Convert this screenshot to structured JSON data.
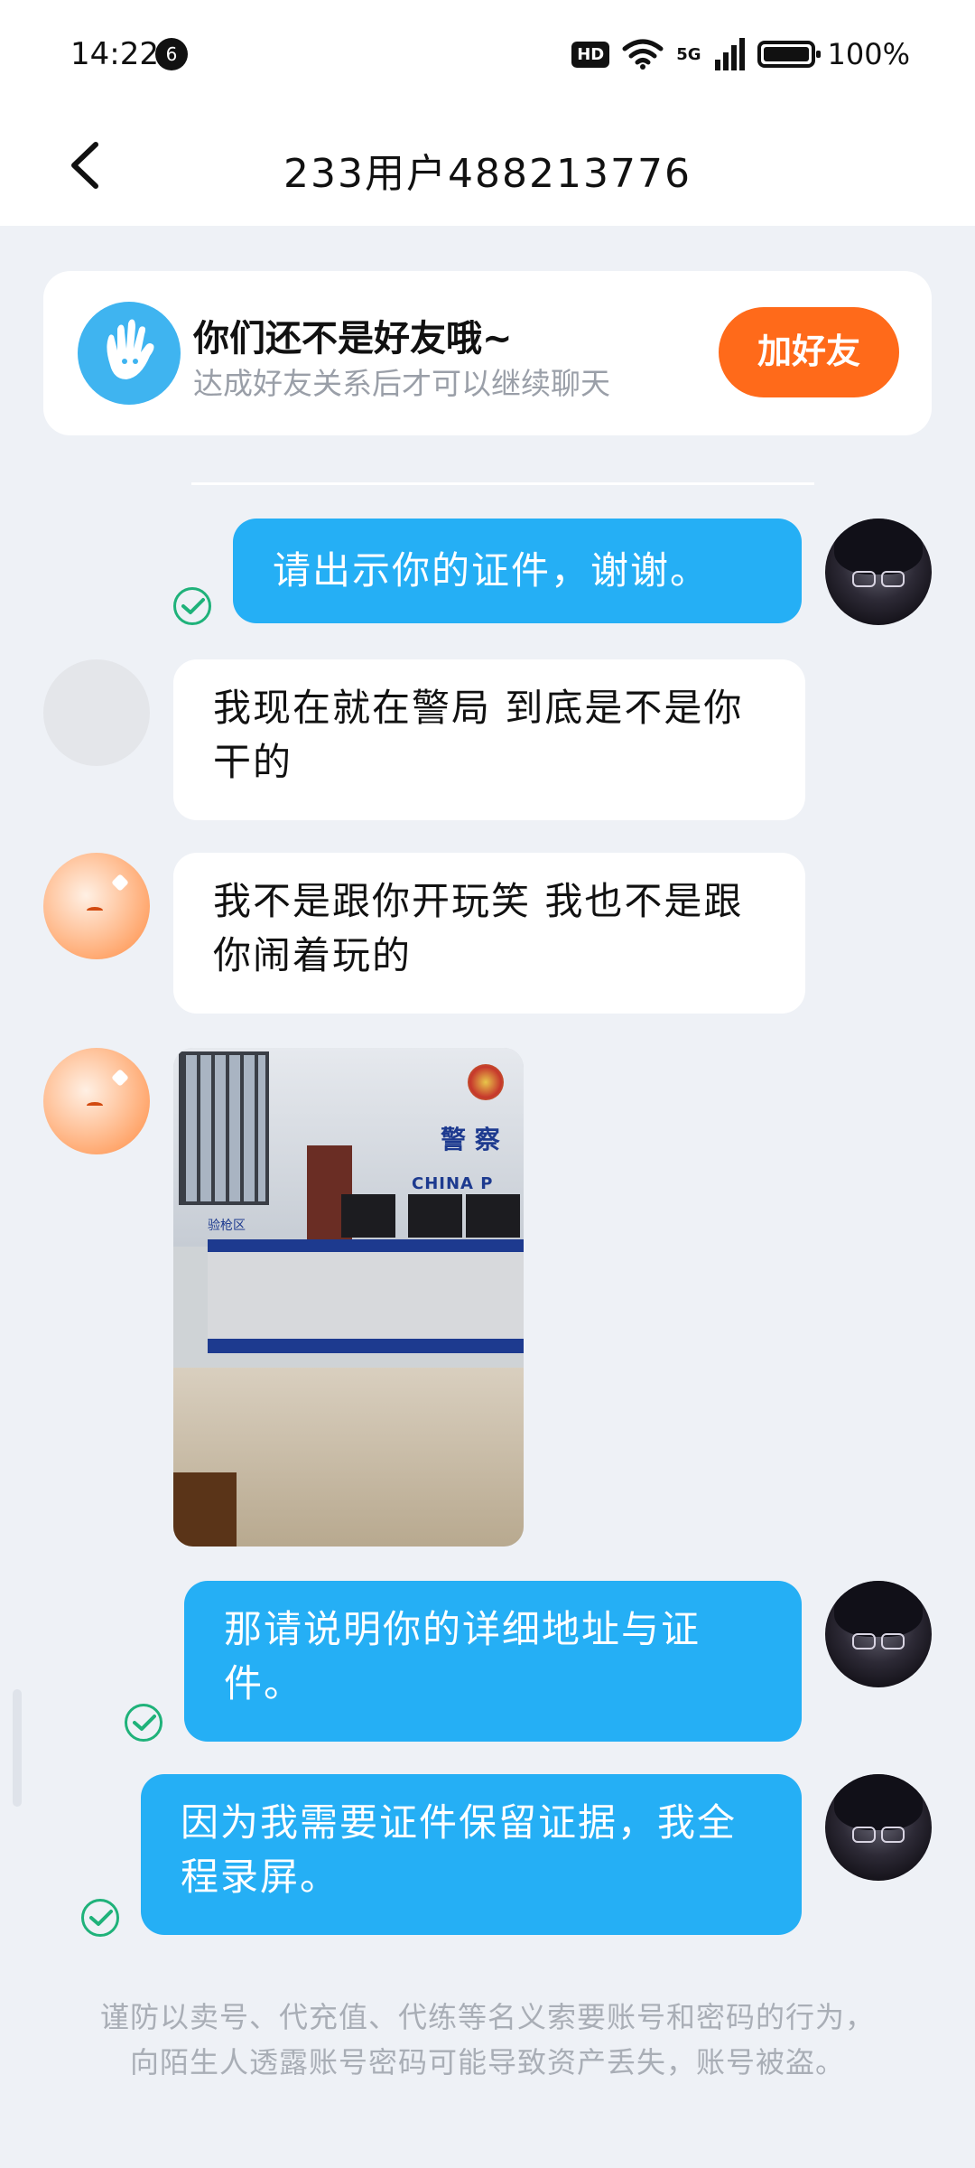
{
  "status_bar": {
    "time": "14:22",
    "notification_count": "6",
    "hd": "HD",
    "network": "5G",
    "battery": "100%"
  },
  "header": {
    "title": "233用户488213776"
  },
  "friend_card": {
    "title": "你们还不是好友哦~",
    "subtitle": "达成好友关系后才可以继续聊天",
    "add_button": "加好友"
  },
  "messages": [
    {
      "side": "out",
      "text": "请出示你的证件，谢谢。",
      "read": true
    },
    {
      "side": "in",
      "text": "我现在就在警局 到底是不是你干的"
    },
    {
      "side": "in",
      "text": "我不是跟你开玩笑 我也不是跟你闹着玩的"
    },
    {
      "side": "in",
      "type": "image",
      "sign_text": "警 察",
      "sign_en": "CHINA P",
      "label": "验枪区"
    },
    {
      "side": "out",
      "text": "那请说明你的详细地址与证件。",
      "read": true
    },
    {
      "side": "out",
      "text": "因为我需要证件保留证据，我全程录屏。",
      "read": true
    }
  ],
  "safety_notice": "谨防以卖号、代充值、代练等名义索要账号和密码的行为，向陌生人透露账号密码可能导致资产丢失，账号被盗。",
  "colors": {
    "outgoing_bubble": "#25aff5",
    "incoming_bubble": "#ffffff",
    "add_friend_button": "#ff6a1a",
    "background": "#eef1f6",
    "read_check": "#1fb27a"
  }
}
